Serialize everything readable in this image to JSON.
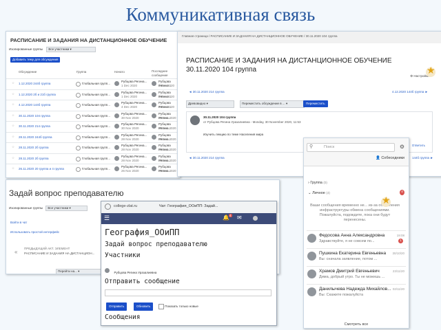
{
  "slide": {
    "title": "Коммуникативная связь"
  },
  "forum_list": {
    "title": "РАСПИСАНИЕ И ЗАДАНИЯ НА ДИСТАНЦИОННОЕ ОБУЧЕНИЕ",
    "group_label": "Изолированные группы",
    "group_value": "Все участники",
    "add_button": "Добавить тему для обсуждения",
    "columns": [
      "Обсуждение",
      "Группа",
      "Начато",
      "Последнее сообщение"
    ],
    "rows": [
      {
        "topic": "1.12.2020 244б группа",
        "group": "Глобальная групп...",
        "author": "Рубцова Регина...",
        "date": "1 Dec 2020"
      },
      {
        "topic": "1.12.2020 2б и 21б группа",
        "group": "Глобальная групп...",
        "author": "Рубцова Регина...",
        "date": "1 Dec 2020"
      },
      {
        "topic": "4.12.2020 144б группа",
        "group": "Глобальная групп...",
        "author": "Рубцова Регина...",
        "date": "4 Dec 2020"
      },
      {
        "topic": "30.11.2020 104 группа",
        "group": "Глобальная групп...",
        "author": "Рубцова Регина...",
        "date": "30 Nov 2020"
      },
      {
        "topic": "30.11.2020 214 группа",
        "group": "Глобальная групп...",
        "author": "Рубцова Регина...",
        "date": "30 Nov 2020"
      },
      {
        "topic": "28.11.2020 244б группа",
        "group": "Глобальная групп...",
        "author": "Рубцова Регина...",
        "date": "28 Nov 2020"
      },
      {
        "topic": "28.11.2020 2б группа",
        "group": "Глобальная групп...",
        "author": "Рубцова Регина...",
        "date": "28 Nov 2020"
      },
      {
        "topic": "28.11.2020 2б группа",
        "group": "Глобальная групп...",
        "author": "Рубцова Регина...",
        "date": "28 Nov 2020"
      },
      {
        "topic": "26.11.2020 20 группа и 4 группа",
        "group": "Глобальная групп...",
        "author": "Рубцова Регина...",
        "date": "26 Nov 2020"
      }
    ]
  },
  "discussion": {
    "breadcrumb": "Главная страница / РАСПИСАНИЕ И ЗАДАНИЯ НА ДИСТАНЦИОННОЕ ОБУЧЕНИЕ / 30.11.2020 104 группа",
    "title_line1": "РАСПИСАНИЕ И ЗАДАНИЯ НА ДИСТАНЦИОННОЕ ОБУЧЕНИЕ",
    "title_line2": "30.11.2020 104 группа",
    "settings": "Настройки",
    "prev": "◄ 30.11.2020 214 группа",
    "next": "4.12.2020 144б группа ►",
    "view_mode": "Древовидно",
    "move_select": "Переместить обсуждение в ...",
    "move_button": "Переместить",
    "post_title": "30.11.2020 104 группа",
    "post_meta": "от Рубцова Регина Уразалиевна - Monday, 30 November 2020, 11:53",
    "post_body": "Изучить лекцию по теме Населения мира",
    "reply": "Ответить",
    "prev_bottom": "◄ 30.11.2020 214 группа",
    "next_bottom": "144б группа ►"
  },
  "ask_teacher": {
    "title": "Задай вопрос преподавателю",
    "group_label": "Изолированные группы",
    "group_value": "Все участники",
    "enter_chat": "Войти в чат",
    "simple_ui": "Использовать простой интерфейс",
    "prev_label": "ПРЕДЫДУЩИЙ АКТ. ЭЛЕМЕНТ",
    "prev_value": "РАСПИСАНИЕ И ЗАДАНИЯ НА ДИСТАНЦИОН...",
    "goto": "Перейти на..."
  },
  "chat": {
    "tab_title": "Чат: География_ООиПП: Задай...",
    "url": "college-zlat.ru",
    "course": "География_ООиПП",
    "heading": "Задай вопрос преподавателю",
    "participants": "Участники",
    "participant_name": "Рубцова Регина Уразалиевна",
    "send_heading": "Отправить сообщение",
    "send_button": "Отправить",
    "refresh_button": "Обновить",
    "only_new": "Показать только новые",
    "messages_heading": "Сообщения",
    "notif_count": "4"
  },
  "messenger": {
    "search_placeholder": "Поиск",
    "contacts": "Собеседники",
    "group_section": "Группа",
    "group_count": "(0)",
    "personal_section": "Личное",
    "personal_count": "(4)",
    "badge": "4",
    "notice": "Ваши сообщения временно не... из-за обновления инфраструктуры обмена сообщениями. Пожалуйста, подождите, пока они будут перенесены.",
    "messages": [
      {
        "name": "Федосова Анна Александровна",
        "text": "Здравствуйте, я не совсем по...",
        "time": "19:08",
        "badge": "1"
      },
      {
        "name": "Пушкина Екатерина Евгеньевна",
        "text": "Вы: сначала заявление, потом ...",
        "time": "30/10/20"
      },
      {
        "name": "Храмов Дмитрий Евгеньевич",
        "text": "Дима, добрый утро. Ты не можешь ...",
        "time": "23/11/20"
      },
      {
        "name": "Данилычева Надежда Михайлов...",
        "text": "Вы: Скажите пожалуйста",
        "time": "02/11/20"
      }
    ],
    "see_all": "Смотреть все"
  }
}
